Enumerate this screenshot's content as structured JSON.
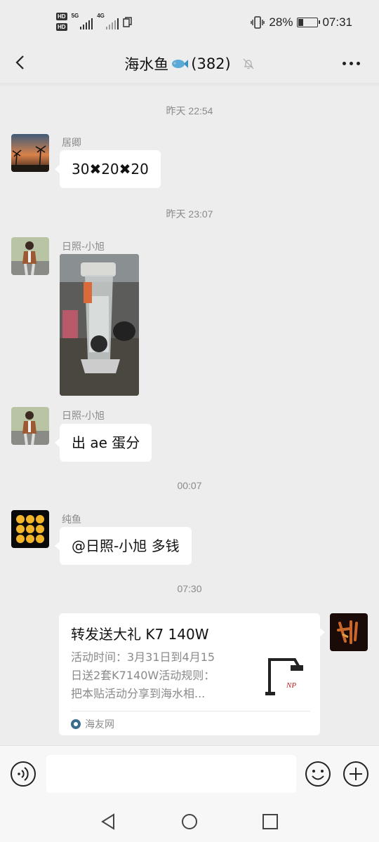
{
  "status_bar": {
    "hd_1": "HD",
    "hd_2": "HD",
    "net_1": "5G",
    "net_2": "4G",
    "battery_pct": "28%",
    "battery_level": 0.28,
    "time": "07:31"
  },
  "header": {
    "title": "海水鱼",
    "member_count": "(382)",
    "icons": [
      "back-arrow-icon",
      "fish-emoji-icon",
      "mute-bell-icon",
      "more-dots-icon"
    ]
  },
  "messages": {
    "t1": "昨天 22:54",
    "m1_sender": "居卿",
    "m1_text": "30✖20✖20",
    "t2": "昨天 23:07",
    "m2_sender": "日照-小旭",
    "m3_sender": "日照-小旭",
    "m3_text": "出 ae 蛋分",
    "t3": "00:07",
    "m4_sender": "纯鱼",
    "m4_text": "@日照-小旭  多钱",
    "t4": "07:30"
  },
  "link_card": {
    "title": "转发送大礼 K7 140W",
    "desc_line1": "活动时间：3月31日到4月15",
    "desc_line2": "日送2套K7140W活动规则：",
    "desc_line3": "把本贴活动分享到海水相...",
    "source": "海友网",
    "thumb_text": "NP"
  },
  "input_bar": {
    "placeholder": "",
    "icons": [
      "voice-icon",
      "emoji-icon",
      "plus-icon"
    ]
  },
  "colors": {
    "background": "#ededed",
    "bubble": "#ffffff",
    "muted_text": "#8a8a8a"
  }
}
